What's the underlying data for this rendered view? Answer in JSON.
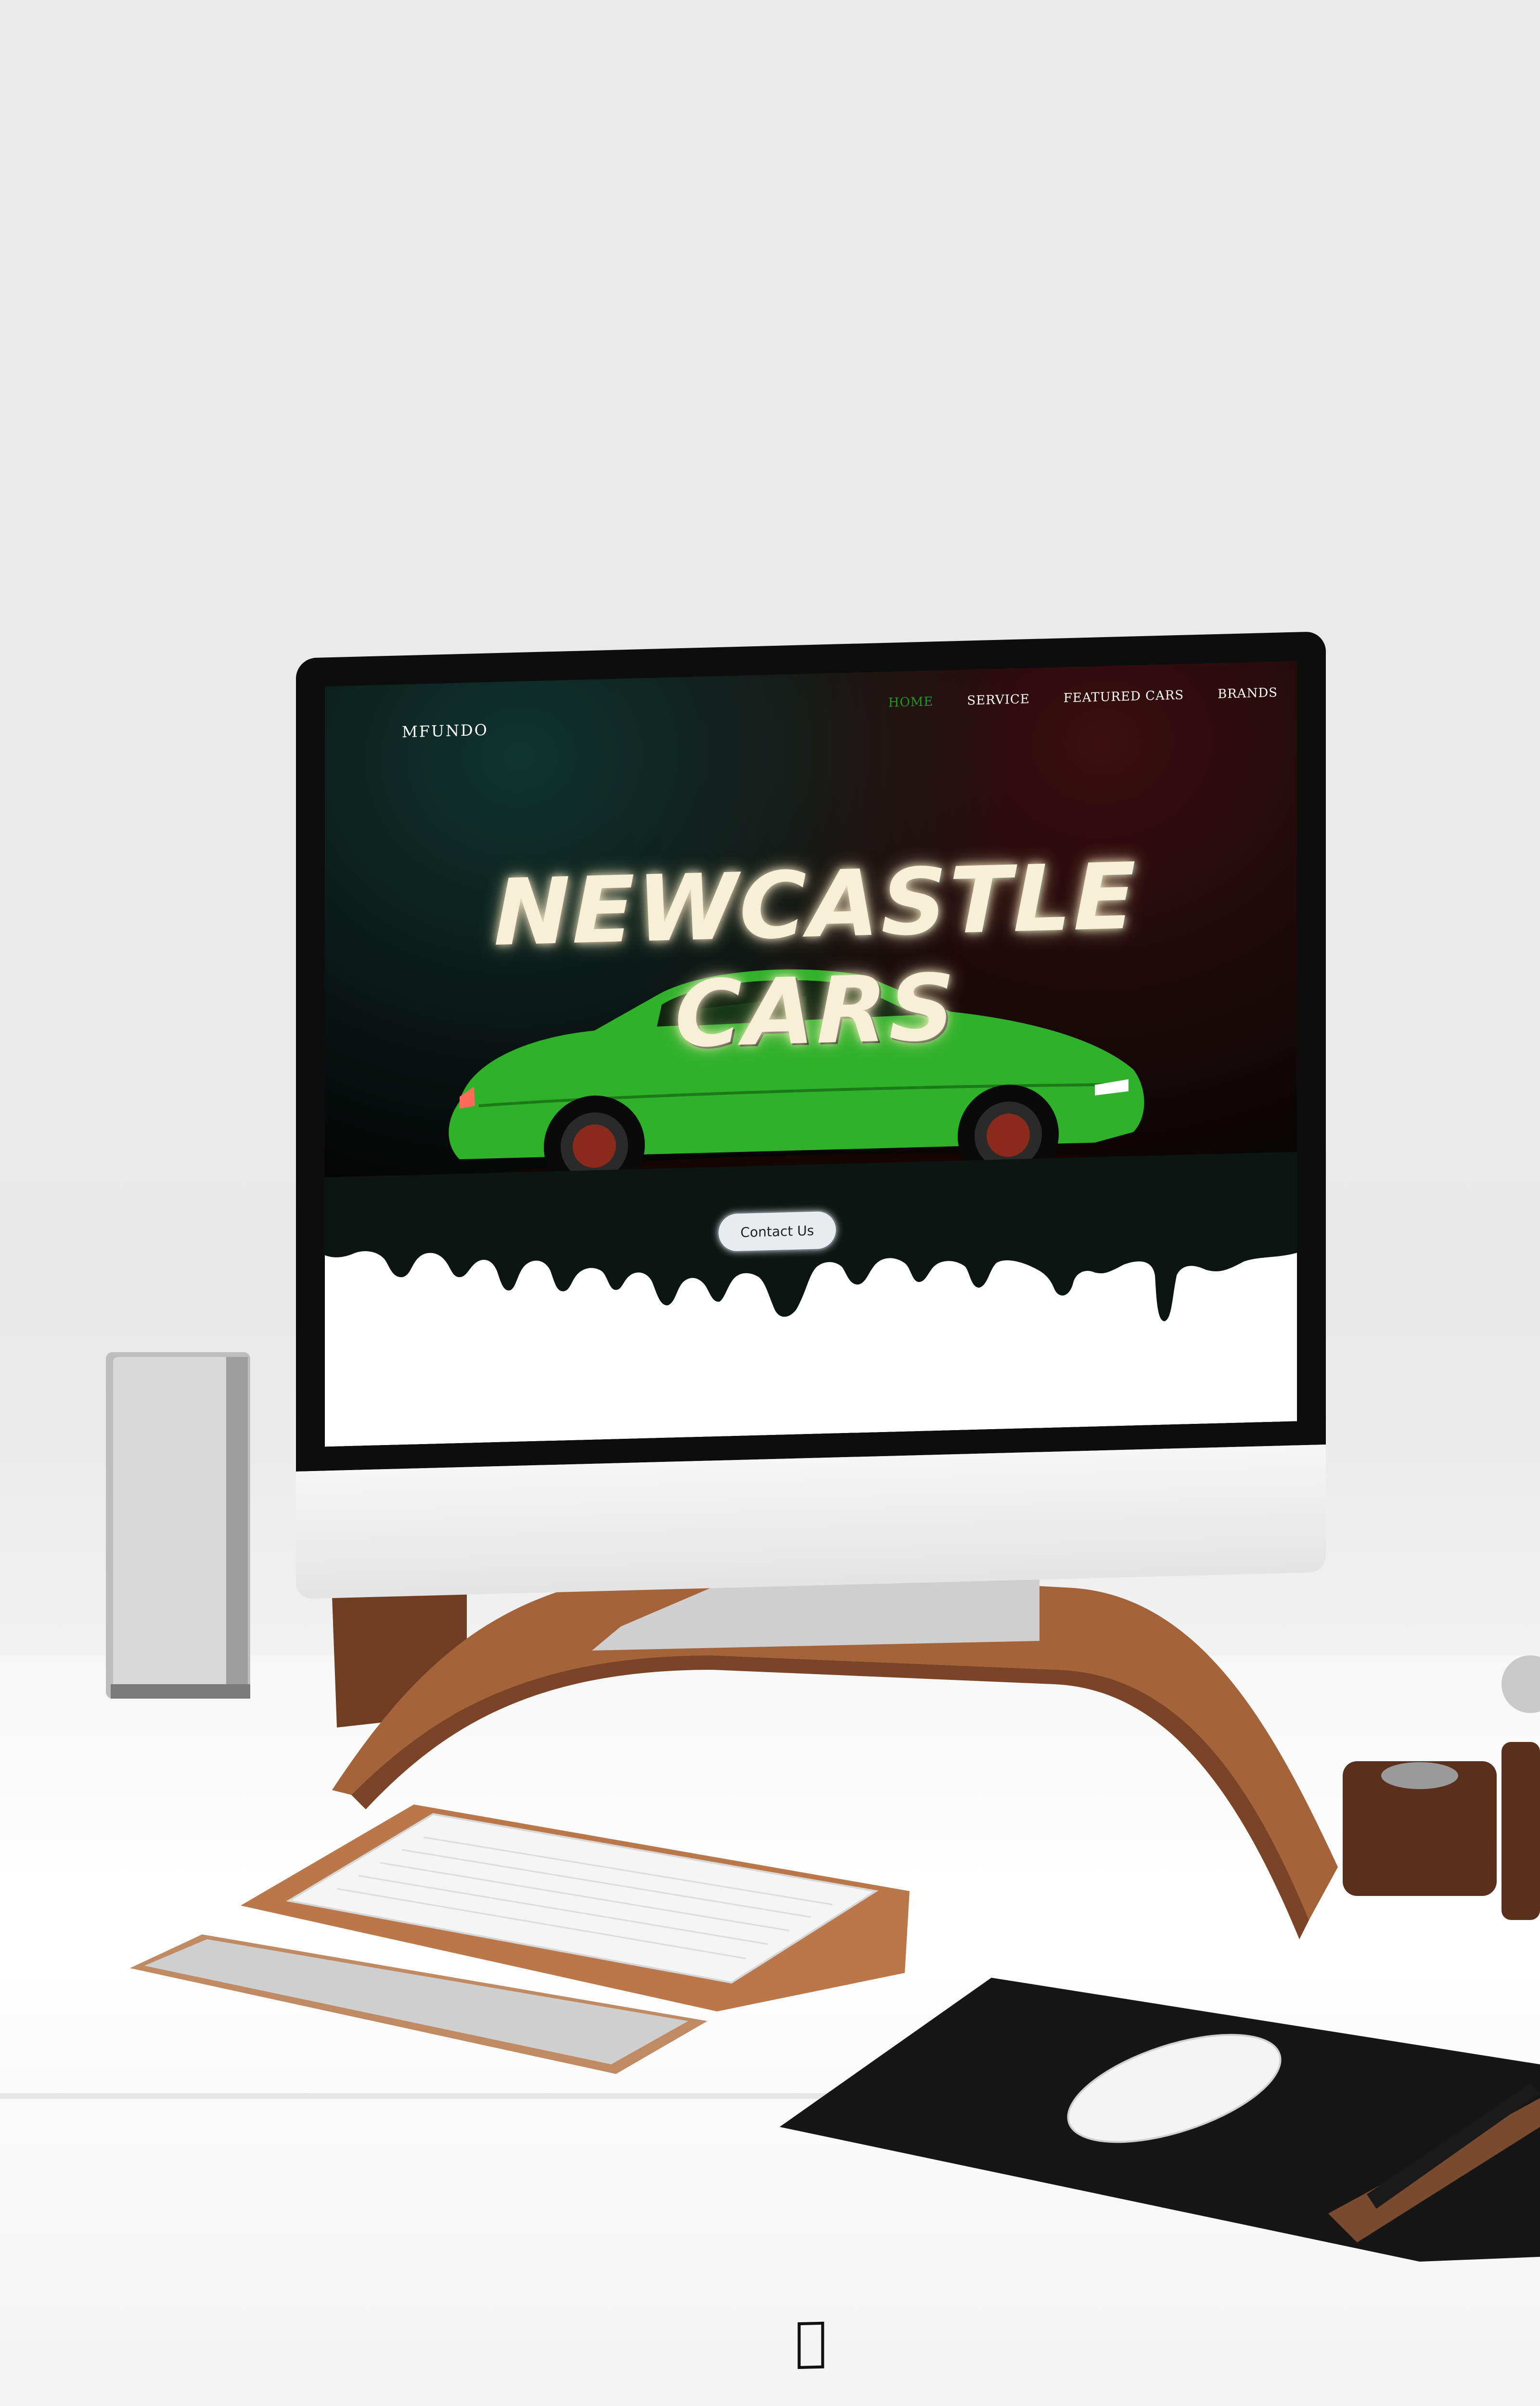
{
  "website": {
    "brand": "MFUNDO",
    "nav": [
      {
        "label": "HOME",
        "active": true
      },
      {
        "label": "SERVICE",
        "active": false
      },
      {
        "label": "FEATURED CARS",
        "active": false
      },
      {
        "label": "BRANDS",
        "active": false
      }
    ],
    "hero_title": "NEWCASTLE CARS",
    "cta_label": "Contact Us"
  },
  "colors": {
    "active_nav": "#1f9a1f",
    "car_body": "#2fb12a",
    "drip_dark": "#0b1512",
    "title_glow": "#f7f0d6"
  },
  "icons": {
    "monitor_logo": "apple-logo-icon",
    "car_image": "green-sports-car-icon"
  }
}
